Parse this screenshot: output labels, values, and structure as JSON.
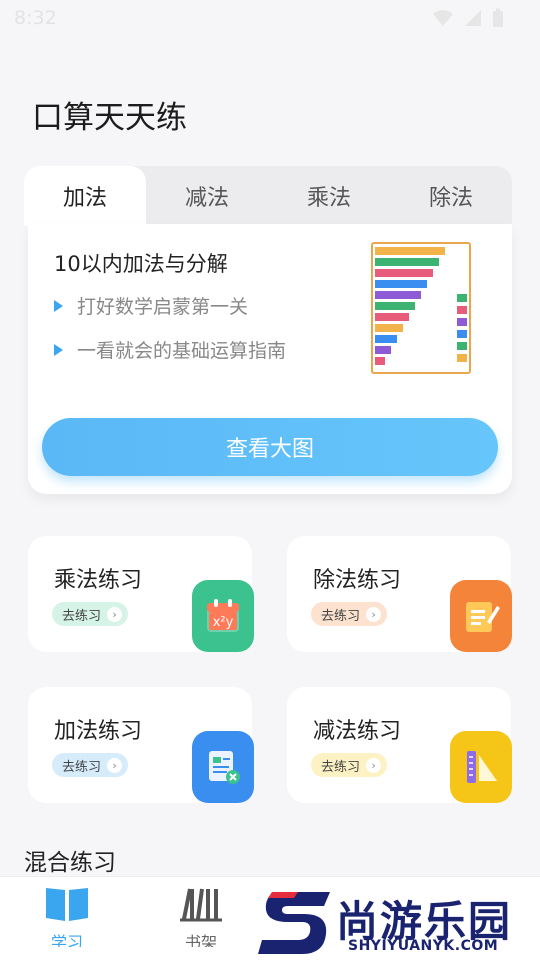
{
  "status_bar": {
    "time": "8:32"
  },
  "page_title": "口算天天练",
  "tabs": [
    {
      "label": "加法",
      "active": true
    },
    {
      "label": "减法",
      "active": false
    },
    {
      "label": "乘法",
      "active": false
    },
    {
      "label": "除法",
      "active": false
    }
  ],
  "panel": {
    "title": "10以内加法与分解",
    "bullets": [
      "打好数学启蒙第一关",
      "一看就会的基础运算指南"
    ],
    "view_button": "查看大图"
  },
  "practice_cards": [
    {
      "title": "乘法练习",
      "go_label": "去练习",
      "icon": "calendar-xy-icon",
      "pill_color": "#d6f3e8",
      "icon_color": "#3cc28f"
    },
    {
      "title": "除法练习",
      "go_label": "去练习",
      "icon": "notepad-pencil-icon",
      "pill_color": "#fde2cf",
      "icon_color": "#f5843b"
    },
    {
      "title": "加法练习",
      "go_label": "去练习",
      "icon": "document-check-icon",
      "pill_color": "#d6ecfb",
      "icon_color": "#3a8ef0"
    },
    {
      "title": "减法练习",
      "go_label": "去练习",
      "icon": "ruler-triangle-icon",
      "pill_color": "#fdf2c4",
      "icon_color": "#f5c518"
    }
  ],
  "section_title": "混合练习",
  "bottom_nav": [
    {
      "icon": "book-icon",
      "label": "学习"
    },
    {
      "icon": "bookshelf-icon",
      "label": "书架"
    }
  ],
  "watermark": {
    "text_cn": "尚游乐园",
    "text_en": "SHYIYUANYK.COM"
  },
  "colors": {
    "accent": "#3aa6ef",
    "button": "#5ab8f6"
  }
}
